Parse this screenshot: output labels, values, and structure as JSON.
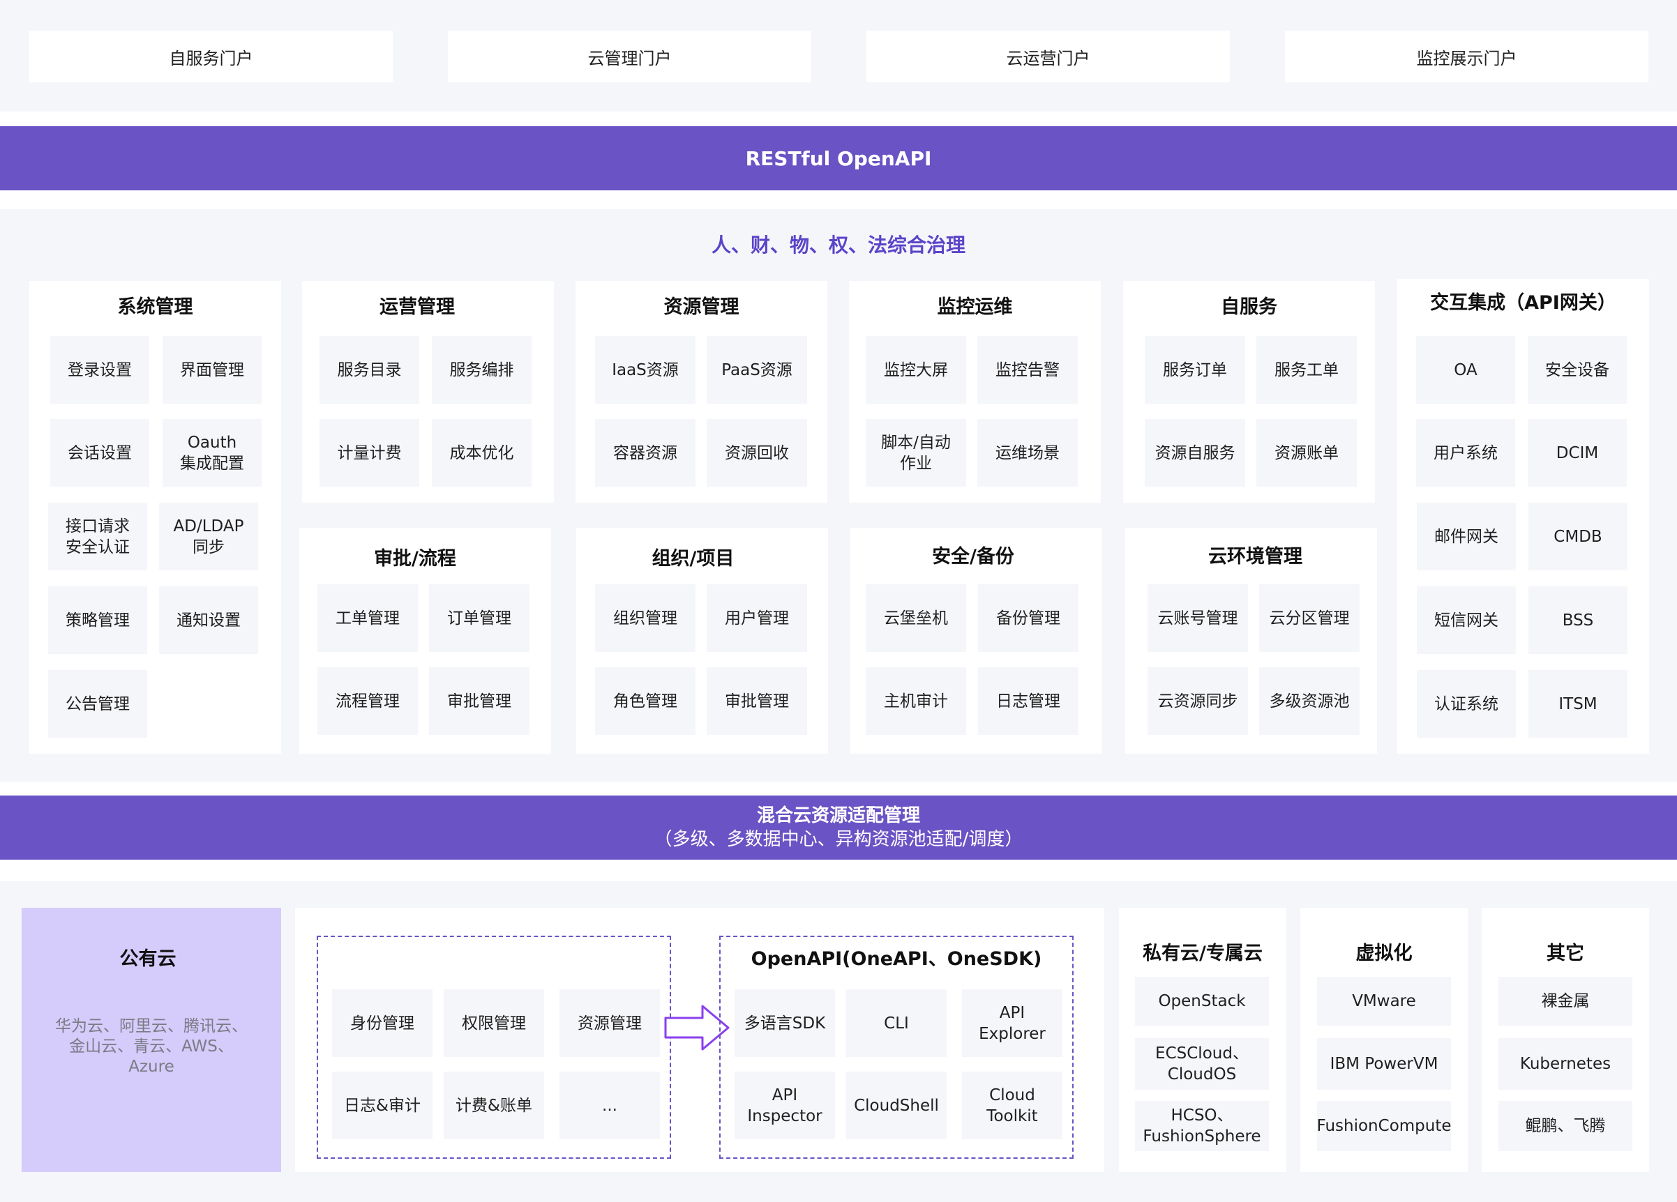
{
  "portals": [
    "自服务门户",
    "云管理门户",
    "云运营门户",
    "监控展示门户"
  ],
  "api_band": "RESTful OpenAPI",
  "governance_title": "人、财、物、权、法综合治理",
  "modules": {
    "system": {
      "title": "系统管理",
      "items": [
        "登录设置",
        "界面管理",
        "会话设置",
        "Oauth\n集成配置",
        "接口请求\n安全认证",
        "AD/LDAP\n同步",
        "策略管理",
        "通知设置",
        "公告管理"
      ]
    },
    "ops": {
      "title": "运营管理",
      "items": [
        "服务目录",
        "服务编排",
        "计量计费",
        "成本优化"
      ]
    },
    "resource": {
      "title": "资源管理",
      "items": [
        "IaaS资源",
        "PaaS资源",
        "容器资源",
        "资源回收"
      ]
    },
    "monitor": {
      "title": "监控运维",
      "items": [
        "监控大屏",
        "监控告警",
        "脚本/自动\n作业",
        "运维场景"
      ]
    },
    "selfservice": {
      "title": "自服务",
      "items": [
        "服务订单",
        "服务工单",
        "资源自服务",
        "资源账单"
      ]
    },
    "integration": {
      "title": "交互集成（API网关）",
      "items": [
        "OA",
        "安全设备",
        "用户系统",
        "DCIM",
        "邮件网关",
        "CMDB",
        "短信网关",
        "BSS",
        "认证系统",
        "ITSM"
      ]
    },
    "approval": {
      "title": "审批/流程",
      "items": [
        "工单管理",
        "订单管理",
        "流程管理",
        "审批管理"
      ]
    },
    "org": {
      "title": "组织/项目",
      "items": [
        "组织管理",
        "用户管理",
        "角色管理",
        "审批管理"
      ]
    },
    "security": {
      "title": "安全/备份",
      "items": [
        "云堡垒机",
        "备份管理",
        "主机审计",
        "日志管理"
      ]
    },
    "cloudenv": {
      "title": "云环境管理",
      "items": [
        "云账号管理",
        "云分区管理",
        "云资源同步",
        "多级资源池"
      ]
    }
  },
  "adapter_band": {
    "title": "混合云资源适配管理",
    "subtitle": "（多级、多数据中心、异构资源池适配/调度）"
  },
  "public_cloud": {
    "title": "公有云",
    "providers": "华为云、阿里云、腾讯云、\n金山云、青云、AWS、\nAzure"
  },
  "capabilities": [
    "身份管理",
    "权限管理",
    "资源管理",
    "日志&审计",
    "计费&账单",
    "..."
  ],
  "openapi": {
    "title": "OpenAPI(OneAPI、OneSDK)",
    "items": [
      "多语言SDK",
      "CLI",
      "API\nExplorer",
      "API\nInspector",
      "CloudShell",
      "Cloud\nToolkit"
    ]
  },
  "private_cloud": {
    "title": "私有云/专属云",
    "items": [
      "OpenStack",
      "ECSCloud、\nCloudOS",
      "HCSO、\nFushionSphere"
    ]
  },
  "virtualization": {
    "title": "虚拟化",
    "items": [
      "VMware",
      "IBM PowerVM",
      "FushionCompute"
    ]
  },
  "others": {
    "title": "其它",
    "items": [
      "裸金属",
      "Kubernetes",
      "鲲鹏、飞腾"
    ]
  },
  "colors": {
    "accent": "#6a53c4",
    "panel": "#f5f6fa",
    "public_cloud_bg": "#d5ccfb",
    "governance_text": "#5b44c8"
  }
}
